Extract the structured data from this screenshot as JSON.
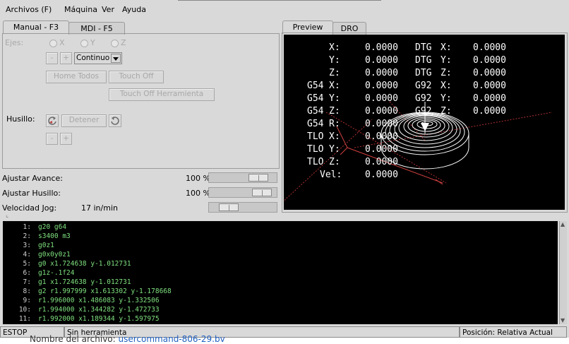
{
  "menus": [
    "Archivos (F)",
    "Máquina",
    "Ver",
    "Ayuda"
  ],
  "tabs_left": [
    "Manual - F3",
    "MDI - F5"
  ],
  "tabs_right": [
    "Preview",
    "DRO"
  ],
  "manual": {
    "ejes_label": "Ejes:",
    "axes": [
      "X",
      "Y",
      "Z"
    ],
    "minus": "-",
    "plus": "+",
    "jog_mode": "Continuo",
    "home_all": "Home Todos",
    "touch_off": "Touch Off",
    "touch_off_tool": "Touch Off Herramienta",
    "spindle_label": "Husillo:",
    "spindle_stop": "Detener"
  },
  "overrides": {
    "feed_label": "Ajustar Avance:",
    "feed_value": "100 %",
    "feed_fraction": 0.82,
    "spindle_label": "Ajustar Husillo:",
    "spindle_value": "100 %",
    "spindle_fraction": 0.9,
    "jog_label": "Velocidad Jog:",
    "jog_value": "17 in/min",
    "jog_fraction": 0.2
  },
  "dro_rows": [
    {
      "l1": "",
      "l2": "X:",
      "v": "0.0000",
      "r1": "DTG",
      "r2": "X:",
      "rv": "0.0000"
    },
    {
      "l1": "",
      "l2": "Y:",
      "v": "0.0000",
      "r1": "DTG",
      "r2": "Y:",
      "rv": "0.0000"
    },
    {
      "l1": "",
      "l2": "Z:",
      "v": "0.0000",
      "r1": "DTG",
      "r2": "Z:",
      "rv": "0.0000"
    },
    {
      "l1": "G54",
      "l2": "X:",
      "v": "0.0000",
      "r1": "G92",
      "r2": "X:",
      "rv": "0.0000"
    },
    {
      "l1": "G54",
      "l2": "Y:",
      "v": "0.0000",
      "r1": "G92",
      "r2": "Y:",
      "rv": "0.0000"
    },
    {
      "l1": "G54",
      "l2": "Z:",
      "v": "0.0000",
      "r1": "G92",
      "r2": "Z:",
      "rv": "0.0000"
    },
    {
      "l1": "G54",
      "l2": "R:",
      "v": "0.0000",
      "r1": "",
      "r2": "",
      "rv": ""
    },
    {
      "l1": "TLO",
      "l2": "X:",
      "v": "0.0000",
      "r1": "",
      "r2": "",
      "rv": ""
    },
    {
      "l1": "TLO",
      "l2": "Y:",
      "v": "0.0000",
      "r1": "",
      "r2": "",
      "rv": ""
    },
    {
      "l1": "TLO",
      "l2": "Z:",
      "v": "0.0000",
      "r1": "",
      "r2": "",
      "rv": ""
    },
    {
      "l1": "",
      "l2": "Vel:",
      "v": "0.0000",
      "r1": "",
      "r2": "",
      "rv": ""
    }
  ],
  "gcode": [
    {
      "n": "1:",
      "t": "g20 g64"
    },
    {
      "n": "2:",
      "t": "s3400 m3"
    },
    {
      "n": "3:",
      "t": "g0z1"
    },
    {
      "n": "4:",
      "t": "g0x0y0z1"
    },
    {
      "n": "5:",
      "t": "g0 x1.724638 y-1.012731"
    },
    {
      "n": "6:",
      "t": "g1z-.1f24"
    },
    {
      "n": "7:",
      "t": "g1 x1.724638 y-1.012731"
    },
    {
      "n": "8:",
      "t": "g2 r1.997999 x1.613302 y-1.178668"
    },
    {
      "n": "9:",
      "t": "r1.996000 x1.486083 y-1.332506"
    },
    {
      "n": "10:",
      "t": "r1.994000 x1.344282 y-1.472733"
    },
    {
      "n": "11:",
      "t": "r1.992000 x1.189344 y-1.597975"
    }
  ],
  "status": {
    "estop": "ESTOP",
    "tool": "Sin herramienta",
    "position": "Posición: Relativa Actual"
  },
  "below": {
    "prefix": "Nombre del archivo:",
    "filename": "usercommand-806-29.bv"
  },
  "colors": {
    "gcode_text": "#7fe07f",
    "preview_bg": "#000000",
    "toolpath": "#ffffff",
    "rapid": "#c04040"
  }
}
